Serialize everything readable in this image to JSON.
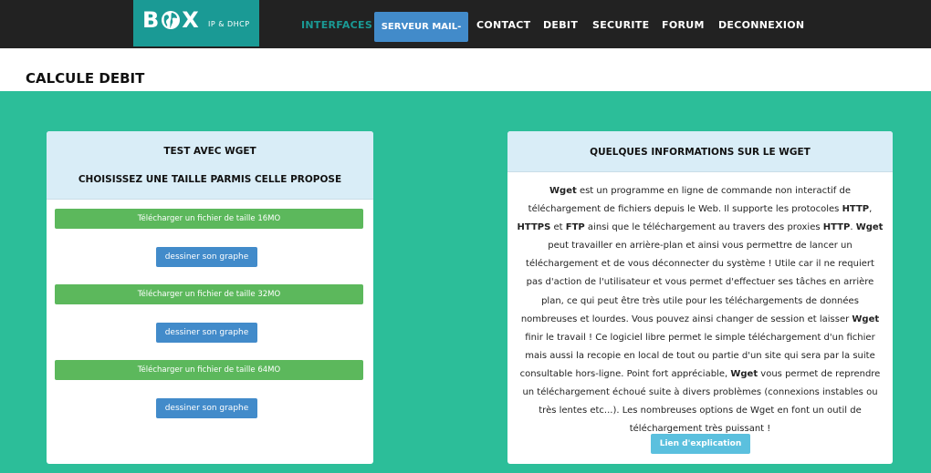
{
  "brand": {
    "name_prefix": "B",
    "name_suffix": "X",
    "subtitle": "IP & DHCP"
  },
  "nav": {
    "interfaces": "INTERFACES",
    "serveur_mail": "SERVEUR MAIL-",
    "contact": "CONTACT",
    "debit": "DEBIT",
    "securite": "SECURITE",
    "forum": "FORUM",
    "deconnexion": "DECONNEXION"
  },
  "page": {
    "title": "CALCULE DEBIT"
  },
  "test_panel": {
    "heading1": "TEST AVEC WGET",
    "heading2": "CHOISISSEZ UNE TAILLE PARMIS CELLE PROPOSE",
    "downloads": [
      {
        "label": "Télécharger un fichier de taille 16MO",
        "graph_label": "dessiner son graphe"
      },
      {
        "label": "Télécharger un fichier de taille 32MO",
        "graph_label": "dessiner son graphe"
      },
      {
        "label": "Télécharger un fichier de taille 64MO",
        "graph_label": "dessiner son graphe"
      }
    ]
  },
  "info_panel": {
    "heading": "QUELQUES INFORMATIONS SUR LE WGET",
    "t1": "Wget",
    "t2": " est un programme en ligne de commande non interactif de téléchargement de fichiers depuis le Web. Il supporte les protocoles ",
    "t3": "HTTP",
    "t4": ", ",
    "t5": "HTTPS",
    "t6": " et ",
    "t7": "FTP",
    "t8": " ainsi que le téléchargement au travers des proxies ",
    "t9": "HTTP",
    "t10": ". ",
    "t11": "Wget",
    "t12": " peut travailler en arrière-plan et ainsi vous permettre de lancer un téléchargement et de vous déconnecter du système ! Utile car il ne requiert pas d'action de l'utilisateur et vous permet d'effectuer ses tâches en arrière plan, ce qui peut être très utile pour les téléchargements de données nombreuses et lourdes. Vous pouvez ainsi changer de session et laisser ",
    "t13": "Wget",
    "t14": " finir le travail ! Ce logiciel libre permet le simple téléchargement d'un fichier mais aussi la recopie en local de tout ou partie d'un site qui sera par la suite consultable hors-ligne. Point fort appréciable, ",
    "t15": "Wget",
    "t16": " vous permet de reprendre un téléchargement échoué suite à divers problèmes (connexions instables ou très lentes etc...). Les nombreuses options de Wget en font un outil de téléchargement très puissant !",
    "link_label": "Lien d'explication"
  },
  "colors": {
    "navbar": "#222222",
    "brand_teal": "#1a9a95",
    "page_green": "#2cbe99",
    "panel_header": "#d9edf7",
    "success": "#5cb85c",
    "primary": "#428bca",
    "info": "#5bc0de"
  },
  "icons": {
    "logo_globe": "globe-icon"
  }
}
